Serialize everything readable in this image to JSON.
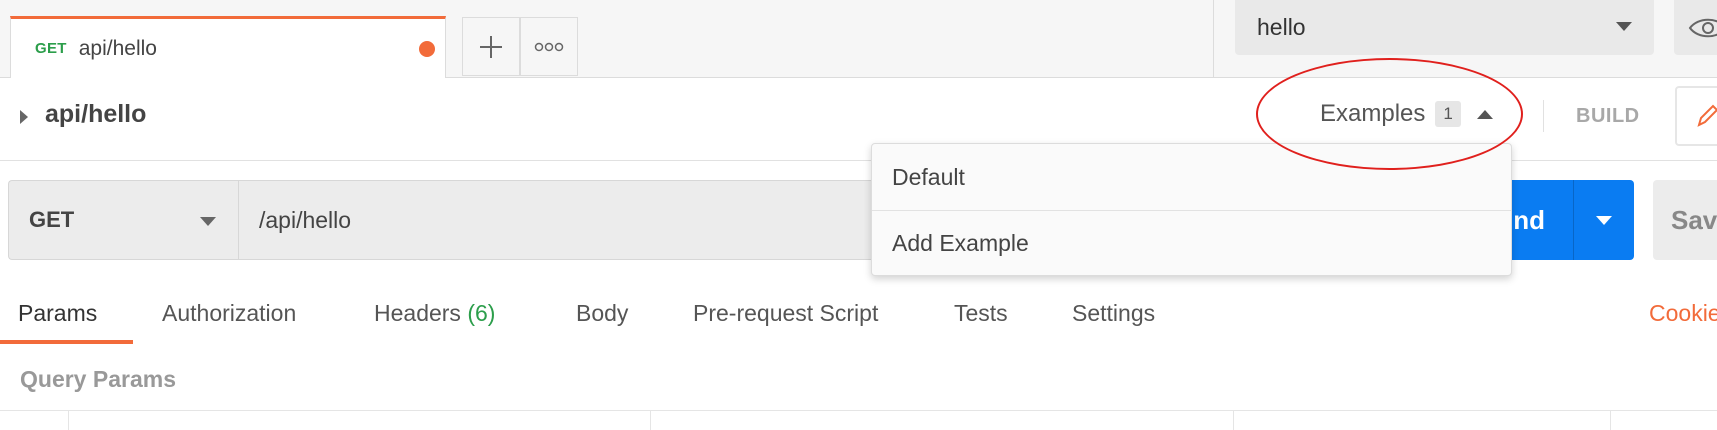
{
  "tabs": {
    "request_tab": {
      "method": "GET",
      "name": "api/hello"
    },
    "add_symbol": "+",
    "more_symbol": "◦◦◦"
  },
  "environment": {
    "selected": "hello"
  },
  "request": {
    "title": "api/hello",
    "examples_label": "Examples",
    "examples_count": "1",
    "build_label": "BUILD"
  },
  "url_bar": {
    "method": "GET",
    "url": "/api/hello",
    "send_label": "Send",
    "send_visible": "nd",
    "save_label": "Sav"
  },
  "examples_menu": {
    "items": [
      {
        "label": "Default"
      },
      {
        "label": "Add Example"
      }
    ]
  },
  "subtabs": {
    "params": "Params",
    "authorization": "Authorization",
    "headers": "Headers",
    "headers_count": "(6)",
    "body": "Body",
    "prerequest": "Pre-request Script",
    "tests": "Tests",
    "settings": "Settings",
    "cookies": "Cookie"
  },
  "query_params": {
    "label": "Query Params"
  },
  "colors": {
    "accent_orange": "#f26b3a",
    "send_blue": "#0a7cf2",
    "get_green": "#2c9e4b",
    "highlight_red": "#e0201d"
  },
  "icons": {
    "add": "plus-icon",
    "more": "more-icon",
    "env_caret": "chevron-down-icon",
    "env_eye": "eye-icon",
    "expand": "caret-right-icon",
    "examples_caret": "chevron-up-icon",
    "edit": "pencil-icon",
    "send_caret": "chevron-down-icon"
  }
}
